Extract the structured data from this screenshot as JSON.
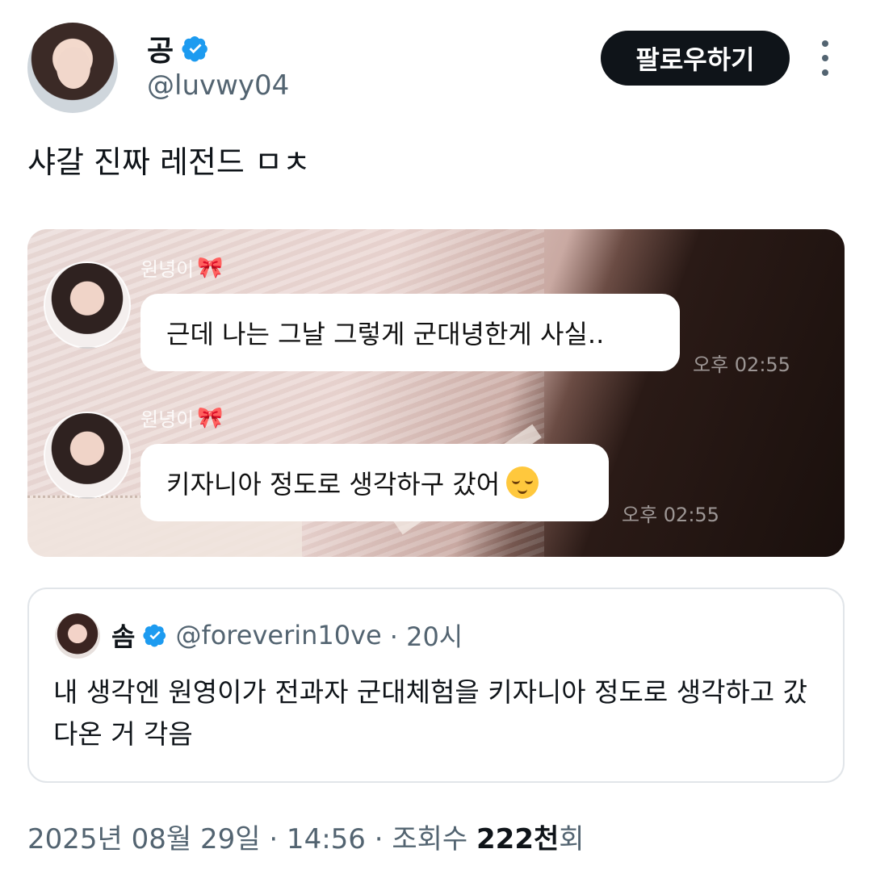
{
  "author": {
    "name": "공",
    "handle": "@luvwy04"
  },
  "actions": {
    "follow_label": "팔로우하기",
    "more_icon": "more-vertical-icon"
  },
  "tweet": {
    "text": "샤갈 진짜 레전드 ㅁㅊ"
  },
  "media": {
    "messages": [
      {
        "sender": "원녕이",
        "sender_emoji": "🎀",
        "text": "근데 나는 그날 그렇게 군대녕한게 사실..",
        "time": "오후 02:55"
      },
      {
        "sender": "원녕이",
        "sender_emoji": "🎀",
        "text": "키자니아 정도로 생각하구 갔어",
        "time": "오후 02:55"
      }
    ]
  },
  "quote": {
    "name": "솜",
    "handle": "@foreverin10ve",
    "age": "· 20시",
    "text": "내 생각엔 원영이가 전과자 군대체험을 키자니아 정도로 생각하고 갔다온 거 각음"
  },
  "meta": {
    "date": "2025년 08월 29일 · 14:56 · 조회수 ",
    "views_number": "222천",
    "views_suffix": "회"
  },
  "colors": {
    "verified": "#1d9bf0",
    "follow_bg": "#0f1419",
    "secondary_text": "#536471"
  }
}
